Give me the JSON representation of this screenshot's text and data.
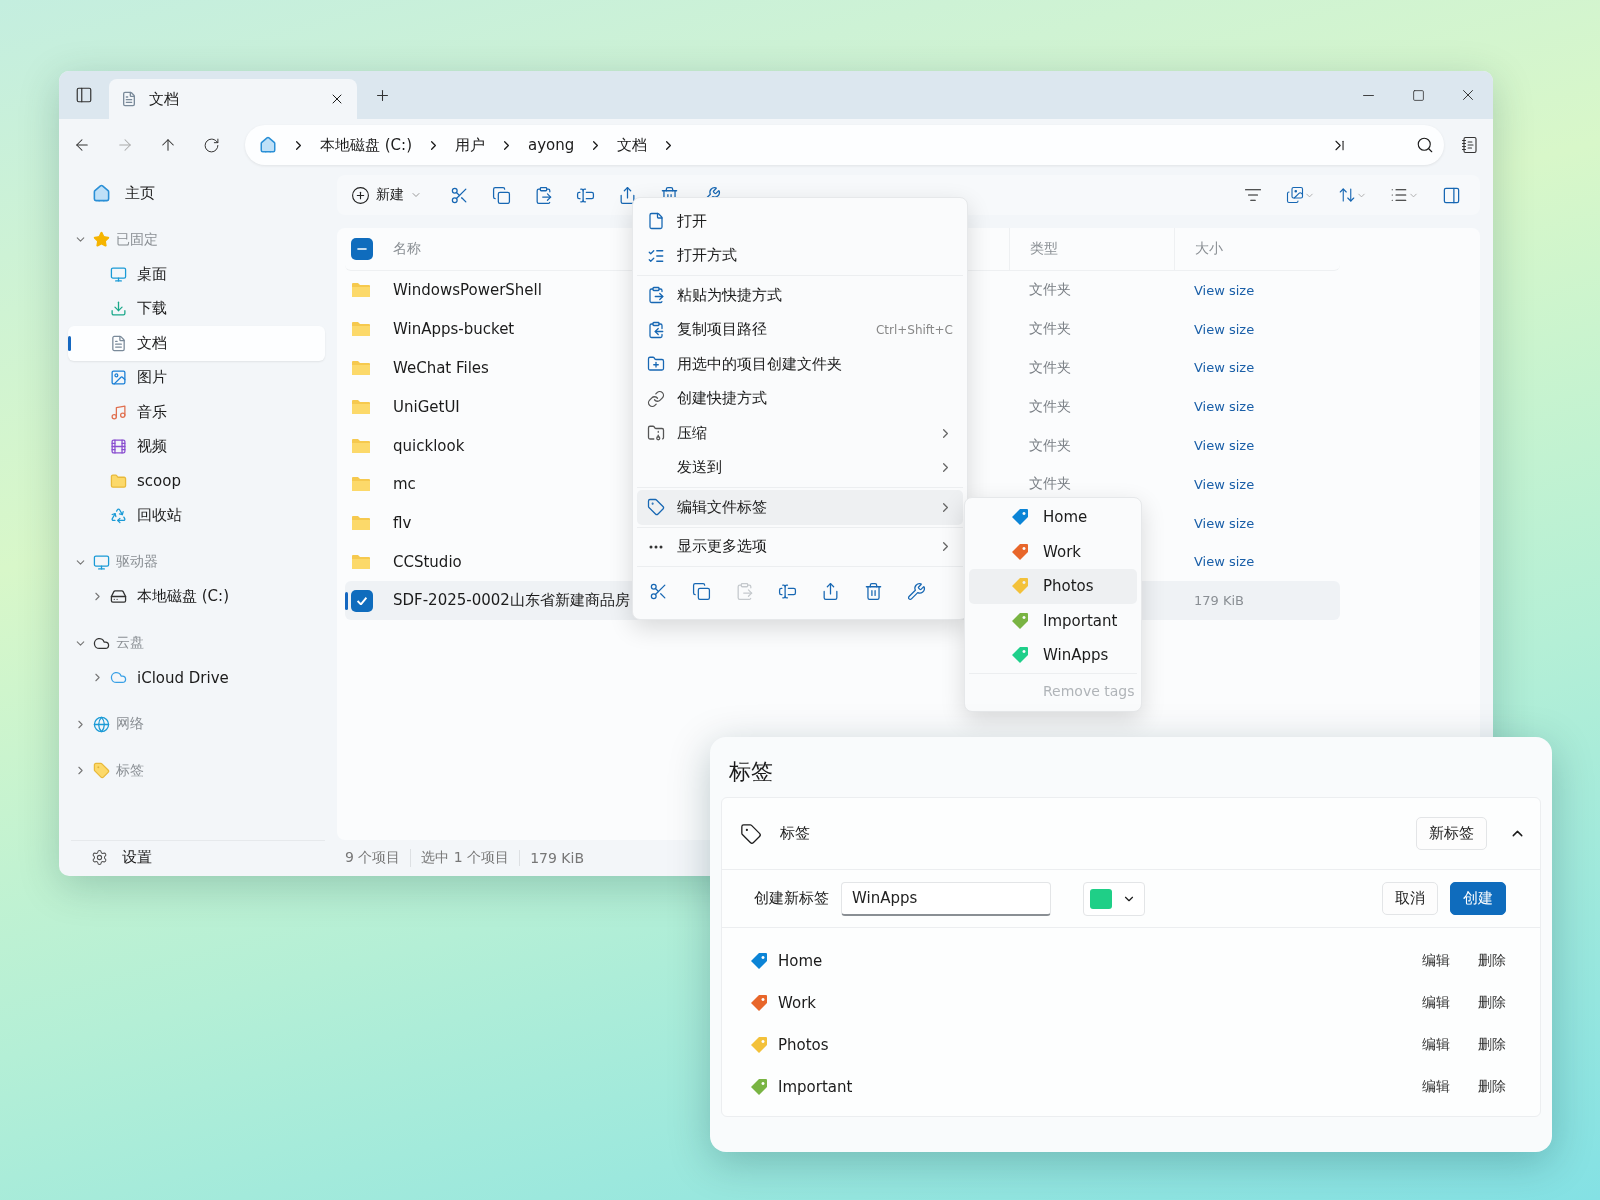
{
  "window": {
    "tab_title": "文档"
  },
  "breadcrumb": [
    "本地磁盘 (C:)",
    "用户",
    "ayong",
    "文档"
  ],
  "sidebar": {
    "home": "主页",
    "sections": [
      {
        "label": "已固定",
        "kind": "pinned",
        "expanded": true,
        "items": [
          {
            "label": "桌面",
            "kind": "desktop",
            "selected": false
          },
          {
            "label": "下载",
            "kind": "downloads",
            "selected": false
          },
          {
            "label": "文档",
            "kind": "documents",
            "selected": true
          },
          {
            "label": "图片",
            "kind": "pictures",
            "selected": false
          },
          {
            "label": "音乐",
            "kind": "music",
            "selected": false
          },
          {
            "label": "视频",
            "kind": "videos",
            "selected": false
          },
          {
            "label": "scoop",
            "kind": "folder",
            "selected": false
          },
          {
            "label": "回收站",
            "kind": "recycle",
            "selected": false
          }
        ]
      },
      {
        "label": "驱动器",
        "kind": "drives",
        "expanded": true,
        "items": [
          {
            "label": "本地磁盘 (C:)",
            "kind": "disk",
            "selected": false,
            "expanded": false
          }
        ]
      },
      {
        "label": "云盘",
        "kind": "cloud",
        "expanded": true,
        "items": [
          {
            "label": "iCloud Drive",
            "kind": "icloud",
            "selected": false,
            "expanded": false
          }
        ]
      },
      {
        "label": "网络",
        "kind": "network",
        "expanded": false
      },
      {
        "label": "标签",
        "kind": "tags",
        "expanded": false
      }
    ],
    "settings": "设置"
  },
  "toolbar": {
    "new": "新建"
  },
  "columns": {
    "name": "名称",
    "type": "类型",
    "size": "大小"
  },
  "select_all": {
    "checked": true,
    "indeterminate": true
  },
  "rows": [
    {
      "name": "WindowsPowerShell",
      "kind": "folder",
      "type": "文件夹",
      "size": "View size",
      "selected": false
    },
    {
      "name": "WinApps-bucket",
      "kind": "folder",
      "type": "文件夹",
      "size": "View size",
      "selected": false
    },
    {
      "name": "WeChat Files",
      "kind": "folder",
      "type": "文件夹",
      "size": "View size",
      "selected": false
    },
    {
      "name": "UniGetUI",
      "kind": "folder",
      "type": "文件夹",
      "size": "View size",
      "selected": false
    },
    {
      "name": "quicklook",
      "kind": "folder",
      "type": "文件夹",
      "size": "View size",
      "selected": false
    },
    {
      "name": "mc",
      "kind": "folder",
      "type": "文件夹",
      "size": "View size",
      "selected": false
    },
    {
      "name": "flv",
      "kind": "folder",
      "size": "View size",
      "selected": false
    },
    {
      "name": "CCStudio",
      "kind": "folder",
      "size": "View size",
      "selected": false
    },
    {
      "name": "SDF-2025-0002山东省新建商品房",
      "kind": "file",
      "size": "179 KiB",
      "selected": true
    }
  ],
  "status_bar": [
    "9 个项目",
    "选中 1 个项目",
    "179 KiB"
  ],
  "context_menu": {
    "groups": [
      {
        "items": [
          {
            "label": "打开",
            "kind": "open",
            "submenu": false,
            "highlighted": false
          },
          {
            "label": "打开方式",
            "kind": "open_with",
            "submenu": false,
            "highlighted": false
          }
        ]
      },
      {
        "items": [
          {
            "label": "粘贴为快捷方式",
            "kind": "paste_shortcut",
            "submenu": false,
            "highlighted": false
          },
          {
            "label": "复制项目路径",
            "kind": "copy_path",
            "shortcut": "Ctrl+Shift+C",
            "submenu": false,
            "highlighted": false
          },
          {
            "label": "用选中的项目创建文件夹",
            "kind": "new_folder",
            "submenu": false,
            "highlighted": false
          },
          {
            "label": "创建快捷方式",
            "kind": "shortcut",
            "submenu": false,
            "highlighted": false
          },
          {
            "label": "压缩",
            "kind": "compress",
            "submenu": true,
            "highlighted": false
          },
          {
            "label": "发送到",
            "kind": "send",
            "submenu": true,
            "highlighted": false
          }
        ]
      },
      {
        "items": [
          {
            "label": "编辑文件标签",
            "kind": "tags",
            "submenu": true,
            "highlighted": true
          }
        ]
      },
      {
        "items": [
          {
            "label": "显示更多选项",
            "kind": "more",
            "submenu": true,
            "highlighted": false
          }
        ]
      }
    ],
    "actions": [
      {
        "kind": "cut",
        "disabled": false
      },
      {
        "kind": "copy",
        "disabled": false
      },
      {
        "kind": "paste",
        "disabled": true
      },
      {
        "kind": "rename",
        "disabled": false
      },
      {
        "kind": "share",
        "disabled": false
      },
      {
        "kind": "delete",
        "disabled": false
      },
      {
        "kind": "properties",
        "disabled": false
      }
    ]
  },
  "tag_submenu": {
    "tags": [
      {
        "label": "Home",
        "color": "#0b84d6",
        "highlighted": false
      },
      {
        "label": "Work",
        "color": "#e8662a",
        "highlighted": false
      },
      {
        "label": "Photos",
        "color": "#f3c13a",
        "highlighted": true
      },
      {
        "label": "Important",
        "color": "#79b443",
        "highlighted": false
      },
      {
        "label": "WinApps",
        "color": "#1fcf8a",
        "highlighted": false
      }
    ],
    "remove": "Remove tags",
    "remove_disabled": true
  },
  "dialog": {
    "title": "标签",
    "section": {
      "label": "标签",
      "new_button": "新标签",
      "expanded": true
    },
    "create": {
      "label": "创建新标签",
      "value": "WinApps",
      "color": "#1fcf87",
      "cancel": "取消",
      "submit": "创建"
    },
    "tags": [
      {
        "name": "Home",
        "color": "#0b84d6",
        "edit": "编辑",
        "delete": "删除"
      },
      {
        "name": "Work",
        "color": "#e8662a",
        "edit": "编辑",
        "delete": "删除"
      },
      {
        "name": "Photos",
        "color": "#f3c13a",
        "edit": "编辑",
        "delete": "删除"
      },
      {
        "name": "Important",
        "color": "#79b443",
        "edit": "编辑",
        "delete": "删除"
      }
    ]
  }
}
